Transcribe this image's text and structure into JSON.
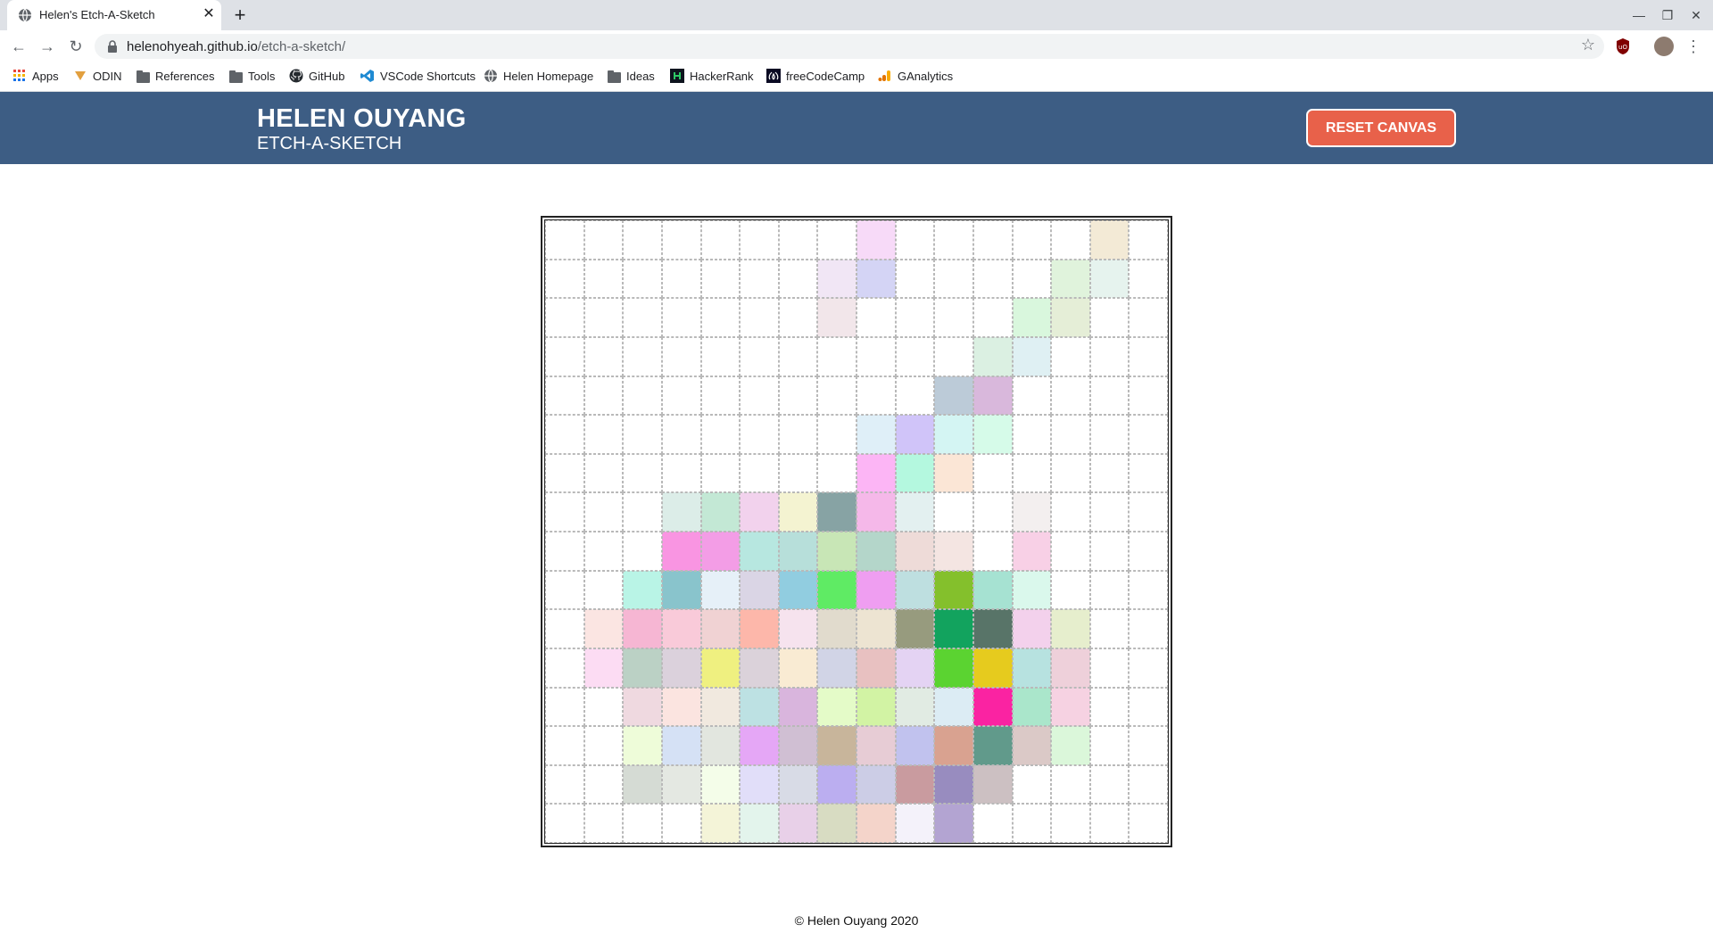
{
  "browser": {
    "tab_title": "Helen's Etch-A-Sketch",
    "tab_close": "✕",
    "new_tab": "+",
    "url_host": "helenohyeah.github.io",
    "url_path": "/etch-a-sketch/",
    "bookmarks": [
      "Apps",
      "ODIN",
      "References",
      "Tools",
      "GitHub",
      "VSCode Shortcuts",
      "Helen Homepage",
      "Ideas",
      "HackerRank",
      "freeCodeCamp",
      "GAnalytics"
    ]
  },
  "header": {
    "title": "HELEN OUYANG",
    "subtitle": "ETCH-A-SKETCH",
    "reset_label": "RESET CANVAS"
  },
  "canvas": {
    "grid_size": 16,
    "colors": [
      [
        "",
        "",
        "",
        "",
        "",
        "",
        "",
        "",
        "#f7daf8",
        "",
        "",
        "",
        "",
        "",
        "#f3ead6",
        ""
      ],
      [
        "",
        "",
        "",
        "",
        "",
        "",
        "",
        "#f1e6f5",
        "#d4d4f5",
        "",
        "",
        "",
        "",
        "#e0f3dc",
        "#e6f3ee",
        ""
      ],
      [
        "",
        "",
        "",
        "",
        "",
        "",
        "",
        "#f2e6ea",
        "",
        "",
        "",
        "",
        "#d9f7dd",
        "#e5eed7",
        "",
        ""
      ],
      [
        "",
        "",
        "",
        "",
        "",
        "",
        "",
        "",
        "",
        "",
        "",
        "#dbf0e2",
        "#dff0f3",
        "",
        "",
        ""
      ],
      [
        "",
        "",
        "",
        "",
        "",
        "",
        "",
        "",
        "",
        "",
        "#bccbd8",
        "#d9b8dc",
        "",
        "",
        "",
        ""
      ],
      [
        "",
        "",
        "",
        "",
        "",
        "",
        "",
        "",
        "#dfeff8",
        "#d0c4f9",
        "#d4f5f3",
        "#d6fbe9",
        "",
        "",
        "",
        ""
      ],
      [
        "",
        "",
        "",
        "",
        "",
        "",
        "",
        "",
        "#fcb5f5",
        "#b4f8df",
        "#fbe6d6",
        "",
        "",
        "",
        "",
        ""
      ],
      [
        "",
        "",
        "",
        "#dcede8",
        "#c3e8d5",
        "#f2d2ed",
        "#f4f3d1",
        "#87a3a4",
        "#f5b8e9",
        "#e3f0f0",
        "",
        "",
        "#f3efef",
        "",
        "",
        ""
      ],
      [
        "",
        "",
        "",
        "#f995e2",
        "#f39de6",
        "#b7e7e0",
        "#b7dfda",
        "#c8e6b6",
        "#b4d6ca",
        "#eedbd8",
        "#f4e5e2",
        "",
        "#f8d0e6",
        "",
        "",
        ""
      ],
      [
        "",
        "",
        "#b9f4e6",
        "#89c4cc",
        "#e6f0f8",
        "#dad5e5",
        "#91cde0",
        "#5feb64",
        "#ef9ef1",
        "#bedfe0",
        "#84c02c",
        "#a6e2d2",
        "#daf8ec",
        "",
        "",
        ""
      ],
      [
        "",
        "#fbe5e2",
        "#f6b6d3",
        "#f9cad9",
        "#f0d2d3",
        "#fdb7aa",
        "#f6e3ee",
        "#e1dbcd",
        "#ede4d2",
        "#979b7e",
        "#12a35e",
        "#587468",
        "#f3d1ec",
        "#e6eecd",
        "",
        ""
      ],
      [
        "",
        "#fcdcf3",
        "#bbd1c5",
        "#dbd1dc",
        "#eff080",
        "#dbd2da",
        "#f9ebd3",
        "#d1d4e6",
        "#e8c1c1",
        "#e4d3f3",
        "#5bd331",
        "#e6cb1e",
        "#b7e2e0",
        "#eed0da",
        "",
        ""
      ],
      [
        "",
        "",
        "#efd9e0",
        "#fbe4e0",
        "#f1e9df",
        "#bde1e3",
        "#d9b5dd",
        "#e4fbc8",
        "#d2f3a4",
        "#e1ebe3",
        "#dcecf4",
        "#fa23a2",
        "#aae6cb",
        "#f6d2e2",
        "",
        ""
      ],
      [
        "",
        "",
        "#eefcd9",
        "#d5e1f5",
        "#e2e6df",
        "#e5a7f6",
        "#d0bfd3",
        "#c8b59b",
        "#e7ccd5",
        "#c1c2ee",
        "#d9a290",
        "#619a8b",
        "#dbc9c7",
        "#dbf7da",
        "",
        ""
      ],
      [
        "",
        "",
        "#d5dbd4",
        "#e4e8e2",
        "#f4fde9",
        "#e1def9",
        "#d8dbe6",
        "#bbaef0",
        "#cccde6",
        "#c99b9f",
        "#988cbf",
        "#ccc0c2",
        "",
        "",
        "",
        ""
      ],
      [
        "",
        "",
        "",
        "",
        "#f4f4d8",
        "#e3f4ec",
        "#e8d0e8",
        "#d8dcc2",
        "#f4d4ca",
        "#f4f2fa",
        "#b3a4d2",
        "",
        "",
        "",
        "",
        ""
      ]
    ]
  },
  "footer": {
    "text": "© Helen Ouyang 2020"
  }
}
